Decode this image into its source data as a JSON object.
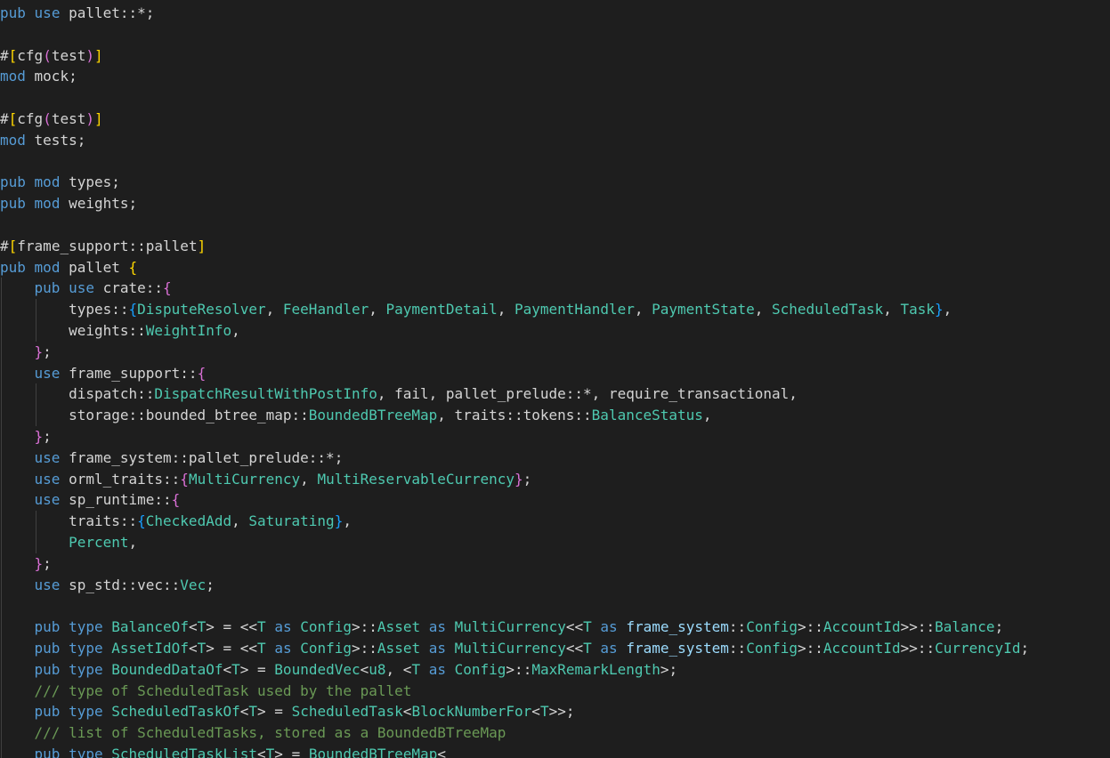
{
  "editor": {
    "colors": {
      "background": "#1e1e1e",
      "keyword": "#569cd6",
      "keyword2": "#c586c0",
      "type": "#4ec9b0",
      "ident": "#d4d4d4",
      "var": "#9cdcfe",
      "comment": "#6a9955",
      "brace1": "#ffd700",
      "brace2": "#da70d6",
      "brace3": "#179fff"
    },
    "lines": [
      {
        "indent": 0,
        "tokens": [
          [
            "keyword",
            "pub"
          ],
          [
            "ident",
            " "
          ],
          [
            "keyword",
            "use"
          ],
          [
            "ident",
            " pallet::*;"
          ]
        ]
      },
      {
        "indent": 0,
        "tokens": []
      },
      {
        "indent": 0,
        "tokens": [
          [
            "attr",
            "#"
          ],
          [
            "brace1",
            "["
          ],
          [
            "attr",
            "cfg"
          ],
          [
            "brace2",
            "("
          ],
          [
            "attr",
            "test"
          ],
          [
            "brace2",
            ")"
          ],
          [
            "brace1",
            "]"
          ]
        ]
      },
      {
        "indent": 0,
        "tokens": [
          [
            "keyword",
            "mod"
          ],
          [
            "ident",
            " mock;"
          ]
        ]
      },
      {
        "indent": 0,
        "tokens": []
      },
      {
        "indent": 0,
        "tokens": [
          [
            "attr",
            "#"
          ],
          [
            "brace1",
            "["
          ],
          [
            "attr",
            "cfg"
          ],
          [
            "brace2",
            "("
          ],
          [
            "attr",
            "test"
          ],
          [
            "brace2",
            ")"
          ],
          [
            "brace1",
            "]"
          ]
        ]
      },
      {
        "indent": 0,
        "tokens": [
          [
            "keyword",
            "mod"
          ],
          [
            "ident",
            " tests;"
          ]
        ]
      },
      {
        "indent": 0,
        "tokens": []
      },
      {
        "indent": 0,
        "tokens": [
          [
            "keyword",
            "pub"
          ],
          [
            "ident",
            " "
          ],
          [
            "keyword",
            "mod"
          ],
          [
            "ident",
            " types;"
          ]
        ]
      },
      {
        "indent": 0,
        "tokens": [
          [
            "keyword",
            "pub"
          ],
          [
            "ident",
            " "
          ],
          [
            "keyword",
            "mod"
          ],
          [
            "ident",
            " weights;"
          ]
        ]
      },
      {
        "indent": 0,
        "tokens": []
      },
      {
        "indent": 0,
        "tokens": [
          [
            "attr",
            "#"
          ],
          [
            "brace1",
            "["
          ],
          [
            "attr",
            "frame_support::pallet"
          ],
          [
            "brace1",
            "]"
          ]
        ]
      },
      {
        "indent": 0,
        "tokens": [
          [
            "keyword",
            "pub"
          ],
          [
            "ident",
            " "
          ],
          [
            "keyword",
            "mod"
          ],
          [
            "ident",
            " pallet "
          ],
          [
            "brace1",
            "{"
          ]
        ]
      },
      {
        "indent": 1,
        "tokens": [
          [
            "keyword",
            "pub"
          ],
          [
            "ident",
            " "
          ],
          [
            "keyword",
            "use"
          ],
          [
            "ident",
            " crate::"
          ],
          [
            "brace2",
            "{"
          ]
        ]
      },
      {
        "indent": 2,
        "tokens": [
          [
            "ident",
            "types::"
          ],
          [
            "brace3",
            "{"
          ],
          [
            "type",
            "DisputeResolver"
          ],
          [
            "ident",
            ", "
          ],
          [
            "type",
            "FeeHandler"
          ],
          [
            "ident",
            ", "
          ],
          [
            "type",
            "PaymentDetail"
          ],
          [
            "ident",
            ", "
          ],
          [
            "type",
            "PaymentHandler"
          ],
          [
            "ident",
            ", "
          ],
          [
            "type",
            "PaymentState"
          ],
          [
            "ident",
            ", "
          ],
          [
            "type",
            "ScheduledTask"
          ],
          [
            "ident",
            ", "
          ],
          [
            "type",
            "Task"
          ],
          [
            "brace3",
            "}"
          ],
          [
            "ident",
            ","
          ]
        ]
      },
      {
        "indent": 2,
        "tokens": [
          [
            "ident",
            "weights::"
          ],
          [
            "type",
            "WeightInfo"
          ],
          [
            "ident",
            ","
          ]
        ]
      },
      {
        "indent": 1,
        "tokens": [
          [
            "brace2",
            "}"
          ],
          [
            "ident",
            ";"
          ]
        ]
      },
      {
        "indent": 1,
        "tokens": [
          [
            "keyword",
            "use"
          ],
          [
            "ident",
            " frame_support::"
          ],
          [
            "brace2",
            "{"
          ]
        ]
      },
      {
        "indent": 2,
        "tokens": [
          [
            "ident",
            "dispatch::"
          ],
          [
            "type",
            "DispatchResultWithPostInfo"
          ],
          [
            "ident",
            ", fail, pallet_prelude::*, require_transactional,"
          ]
        ]
      },
      {
        "indent": 2,
        "tokens": [
          [
            "ident",
            "storage::bounded_btree_map::"
          ],
          [
            "type",
            "BoundedBTreeMap"
          ],
          [
            "ident",
            ", traits::tokens::"
          ],
          [
            "type",
            "BalanceStatus"
          ],
          [
            "ident",
            ","
          ]
        ]
      },
      {
        "indent": 1,
        "tokens": [
          [
            "brace2",
            "}"
          ],
          [
            "ident",
            ";"
          ]
        ]
      },
      {
        "indent": 1,
        "tokens": [
          [
            "keyword",
            "use"
          ],
          [
            "ident",
            " frame_system::pallet_prelude::*;"
          ]
        ]
      },
      {
        "indent": 1,
        "tokens": [
          [
            "keyword",
            "use"
          ],
          [
            "ident",
            " orml_traits::"
          ],
          [
            "brace2",
            "{"
          ],
          [
            "type",
            "MultiCurrency"
          ],
          [
            "ident",
            ", "
          ],
          [
            "type",
            "MultiReservableCurrency"
          ],
          [
            "brace2",
            "}"
          ],
          [
            "ident",
            ";"
          ]
        ]
      },
      {
        "indent": 1,
        "tokens": [
          [
            "keyword",
            "use"
          ],
          [
            "ident",
            " sp_runtime::"
          ],
          [
            "brace2",
            "{"
          ]
        ]
      },
      {
        "indent": 2,
        "tokens": [
          [
            "ident",
            "traits::"
          ],
          [
            "brace3",
            "{"
          ],
          [
            "type",
            "CheckedAdd"
          ],
          [
            "ident",
            ", "
          ],
          [
            "type",
            "Saturating"
          ],
          [
            "brace3",
            "}"
          ],
          [
            "ident",
            ","
          ]
        ]
      },
      {
        "indent": 2,
        "tokens": [
          [
            "type",
            "Percent"
          ],
          [
            "ident",
            ","
          ]
        ]
      },
      {
        "indent": 1,
        "tokens": [
          [
            "brace2",
            "}"
          ],
          [
            "ident",
            ";"
          ]
        ]
      },
      {
        "indent": 1,
        "tokens": [
          [
            "keyword",
            "use"
          ],
          [
            "ident",
            " sp_std::vec::"
          ],
          [
            "type",
            "Vec"
          ],
          [
            "ident",
            ";"
          ]
        ]
      },
      {
        "indent": 1,
        "tokens": []
      },
      {
        "indent": 1,
        "tokens": [
          [
            "keyword",
            "pub"
          ],
          [
            "ident",
            " "
          ],
          [
            "keyword",
            "type"
          ],
          [
            "ident",
            " "
          ],
          [
            "type",
            "BalanceOf"
          ],
          [
            "ident",
            "<"
          ],
          [
            "type",
            "T"
          ],
          [
            "ident",
            "> = <<"
          ],
          [
            "type",
            "T"
          ],
          [
            "ident",
            " "
          ],
          [
            "keyword",
            "as"
          ],
          [
            "ident",
            " "
          ],
          [
            "type",
            "Config"
          ],
          [
            "ident",
            ">::"
          ],
          [
            "type",
            "Asset"
          ],
          [
            "ident",
            " "
          ],
          [
            "keyword",
            "as"
          ],
          [
            "ident",
            " "
          ],
          [
            "type",
            "MultiCurrency"
          ],
          [
            "ident",
            "<<"
          ],
          [
            "type",
            "T"
          ],
          [
            "ident",
            " "
          ],
          [
            "keyword",
            "as"
          ],
          [
            "ident",
            " "
          ],
          [
            "var",
            "frame_system"
          ],
          [
            "ident",
            "::"
          ],
          [
            "type",
            "Config"
          ],
          [
            "ident",
            ">::"
          ],
          [
            "type",
            "AccountId"
          ],
          [
            "ident",
            ">>::"
          ],
          [
            "type",
            "Balance"
          ],
          [
            "ident",
            ";"
          ]
        ]
      },
      {
        "indent": 1,
        "tokens": [
          [
            "keyword",
            "pub"
          ],
          [
            "ident",
            " "
          ],
          [
            "keyword",
            "type"
          ],
          [
            "ident",
            " "
          ],
          [
            "type",
            "AssetIdOf"
          ],
          [
            "ident",
            "<"
          ],
          [
            "type",
            "T"
          ],
          [
            "ident",
            "> = <<"
          ],
          [
            "type",
            "T"
          ],
          [
            "ident",
            " "
          ],
          [
            "keyword",
            "as"
          ],
          [
            "ident",
            " "
          ],
          [
            "type",
            "Config"
          ],
          [
            "ident",
            ">::"
          ],
          [
            "type",
            "Asset"
          ],
          [
            "ident",
            " "
          ],
          [
            "keyword",
            "as"
          ],
          [
            "ident",
            " "
          ],
          [
            "type",
            "MultiCurrency"
          ],
          [
            "ident",
            "<<"
          ],
          [
            "type",
            "T"
          ],
          [
            "ident",
            " "
          ],
          [
            "keyword",
            "as"
          ],
          [
            "ident",
            " "
          ],
          [
            "var",
            "frame_system"
          ],
          [
            "ident",
            "::"
          ],
          [
            "type",
            "Config"
          ],
          [
            "ident",
            ">::"
          ],
          [
            "type",
            "AccountId"
          ],
          [
            "ident",
            ">>::"
          ],
          [
            "type",
            "CurrencyId"
          ],
          [
            "ident",
            ";"
          ]
        ]
      },
      {
        "indent": 1,
        "tokens": [
          [
            "keyword",
            "pub"
          ],
          [
            "ident",
            " "
          ],
          [
            "keyword",
            "type"
          ],
          [
            "ident",
            " "
          ],
          [
            "type",
            "BoundedDataOf"
          ],
          [
            "ident",
            "<"
          ],
          [
            "type",
            "T"
          ],
          [
            "ident",
            "> = "
          ],
          [
            "type",
            "BoundedVec"
          ],
          [
            "ident",
            "<"
          ],
          [
            "type",
            "u8"
          ],
          [
            "ident",
            ", <"
          ],
          [
            "type",
            "T"
          ],
          [
            "ident",
            " "
          ],
          [
            "keyword",
            "as"
          ],
          [
            "ident",
            " "
          ],
          [
            "type",
            "Config"
          ],
          [
            "ident",
            ">::"
          ],
          [
            "type",
            "MaxRemarkLength"
          ],
          [
            "ident",
            ">;"
          ]
        ]
      },
      {
        "indent": 1,
        "tokens": [
          [
            "comment",
            "/// type of ScheduledTask used by the pallet"
          ]
        ]
      },
      {
        "indent": 1,
        "tokens": [
          [
            "keyword",
            "pub"
          ],
          [
            "ident",
            " "
          ],
          [
            "keyword",
            "type"
          ],
          [
            "ident",
            " "
          ],
          [
            "type",
            "ScheduledTaskOf"
          ],
          [
            "ident",
            "<"
          ],
          [
            "type",
            "T"
          ],
          [
            "ident",
            "> = "
          ],
          [
            "type",
            "ScheduledTask"
          ],
          [
            "ident",
            "<"
          ],
          [
            "type",
            "BlockNumberFor"
          ],
          [
            "ident",
            "<"
          ],
          [
            "type",
            "T"
          ],
          [
            "ident",
            ">>;"
          ]
        ]
      },
      {
        "indent": 1,
        "tokens": [
          [
            "comment",
            "/// list of ScheduledTasks, stored as a BoundedBTreeMap"
          ]
        ]
      },
      {
        "indent": 1,
        "tokens": [
          [
            "keyword",
            "pub"
          ],
          [
            "ident",
            " "
          ],
          [
            "keyword",
            "type"
          ],
          [
            "ident",
            " "
          ],
          [
            "type",
            "ScheduledTaskList"
          ],
          [
            "ident",
            "<"
          ],
          [
            "type",
            "T"
          ],
          [
            "ident",
            "> = "
          ],
          [
            "type",
            "BoundedBTreeMap"
          ],
          [
            "ident",
            "<"
          ]
        ]
      }
    ]
  }
}
